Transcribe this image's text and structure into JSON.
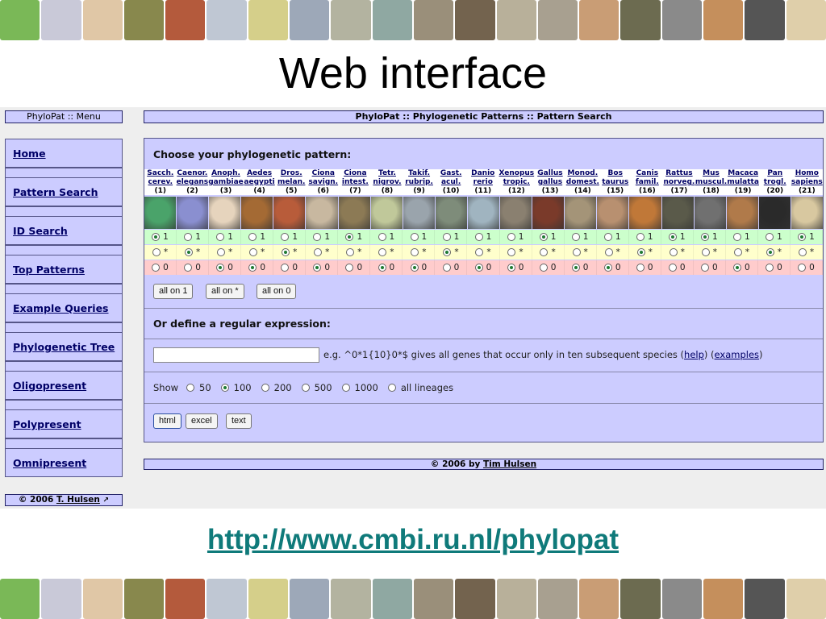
{
  "slide": {
    "title": "Web interface",
    "url": "http://www.cmbi.ru.nl/phylopat"
  },
  "strip_colors": [
    "#7ab857",
    "#c9c9d8",
    "#e0c7a6",
    "#88884d",
    "#b45a3c",
    "#bfc7d3",
    "#d5cf8a",
    "#9da8b8",
    "#b3b3a0",
    "#8fa8a2",
    "#9a8f7a",
    "#73634e",
    "#b8b09a",
    "#a8a090",
    "#c99d75",
    "#6c6b50",
    "#8a8a8a",
    "#c58f5c",
    "#555555",
    "#dfcfaa"
  ],
  "menu": {
    "header": "PhyloPat :: Menu",
    "items": [
      {
        "label": "Home"
      },
      {
        "label": "Pattern Search"
      },
      {
        "label": "ID Search"
      },
      {
        "label": "Top Patterns"
      },
      {
        "label": "Example Queries"
      },
      {
        "label": "Phylogenetic Tree"
      },
      {
        "label": "Oligopresent"
      },
      {
        "label": "Polypresent"
      },
      {
        "label": "Omnipresent"
      }
    ],
    "footer_prefix": "© 2006",
    "footer_link": "T. Hulsen"
  },
  "main": {
    "header": "PhyloPat :: Phylogenetic Patterns :: Pattern Search",
    "choose_label": "Choose your phylogenetic pattern:",
    "species": [
      {
        "l1": "Sacch.",
        "l2": "cerev.",
        "num": "(1)",
        "color": "#4aa36a",
        "sel": 1
      },
      {
        "l1": "Caenor.",
        "l2": "elegans",
        "num": "(2)",
        "color": "#8a8fd0",
        "sel": 2
      },
      {
        "l1": "Anoph.",
        "l2": "gambiae",
        "num": "(3)",
        "color": "#e6d4bd",
        "sel": 3
      },
      {
        "l1": "Aedes",
        "l2": "aegypti",
        "num": "(4)",
        "color": "#a46a34",
        "sel": 3
      },
      {
        "l1": "Dros.",
        "l2": "melan.",
        "num": "(5)",
        "color": "#b85c3a",
        "sel": 2
      },
      {
        "l1": "Ciona",
        "l2": "savign.",
        "num": "(6)",
        "color": "#c8b8a0",
        "sel": 3
      },
      {
        "l1": "Ciona",
        "l2": "intest.",
        "num": "(7)",
        "color": "#8c7a55",
        "sel": 1
      },
      {
        "l1": "Tetr.",
        "l2": "nigrov.",
        "num": "(8)",
        "color": "#c0c89a",
        "sel": 3
      },
      {
        "l1": "Takif.",
        "l2": "rubrip.",
        "num": "(9)",
        "color": "#9aa4ac",
        "sel": 3
      },
      {
        "l1": "Gast.",
        "l2": "acul.",
        "num": "(10)",
        "color": "#7e8c7a",
        "sel": 2
      },
      {
        "l1": "Danio",
        "l2": "rerio",
        "num": "(11)",
        "color": "#a0b4c0",
        "sel": 3
      },
      {
        "l1": "Xenopus",
        "l2": "tropic.",
        "num": "(12)",
        "color": "#8a8070",
        "sel": 3
      },
      {
        "l1": "Gallus",
        "l2": "gallus",
        "num": "(13)",
        "color": "#7a3a2a",
        "sel": 1
      },
      {
        "l1": "Monod.",
        "l2": "domest.",
        "num": "(14)",
        "color": "#a49478",
        "sel": 3
      },
      {
        "l1": "Bos",
        "l2": "taurus",
        "num": "(15)",
        "color": "#b89070",
        "sel": 3
      },
      {
        "l1": "Canis",
        "l2": "famil.",
        "num": "(16)",
        "color": "#c07838",
        "sel": 2
      },
      {
        "l1": "Rattus",
        "l2": "norveg.",
        "num": "(17)",
        "color": "#5a5a4a",
        "sel": 1
      },
      {
        "l1": "Mus",
        "l2": "muscul.",
        "num": "(18)",
        "color": "#707070",
        "sel": 1
      },
      {
        "l1": "Macaca",
        "l2": "mulatta",
        "num": "(19)",
        "color": "#b07a4a",
        "sel": 3
      },
      {
        "l1": "Pan",
        "l2": "trogl.",
        "num": "(20)",
        "color": "#2a2a2a",
        "sel": 2
      },
      {
        "l1": "Homo",
        "l2": "sapiens",
        "num": "(21)",
        "color": "#d8c8a0",
        "sel": 1
      }
    ],
    "row_values": [
      "1",
      "*",
      "0"
    ],
    "buttons": {
      "all1": "all on 1",
      "allstar": "all on *",
      "all0": "all on 0"
    },
    "regex_title": "Or define a regular expression:",
    "regex_hint_prefix": "e.g. ^0*1{10}0*$ gives all genes that occur only in ten subsequent species (",
    "regex_help": "help",
    "regex_mid": ") (",
    "regex_examples": "examples",
    "regex_suffix": ")",
    "show_label": "Show",
    "show_options": [
      "50",
      "100",
      "200",
      "500",
      "1000",
      "all lineages"
    ],
    "show_selected": "100",
    "format_buttons": {
      "html": "html",
      "excel": "excel",
      "text": "text"
    },
    "copyright_prefix": "© 2006 by",
    "copyright_link": "Tim Hulsen"
  }
}
